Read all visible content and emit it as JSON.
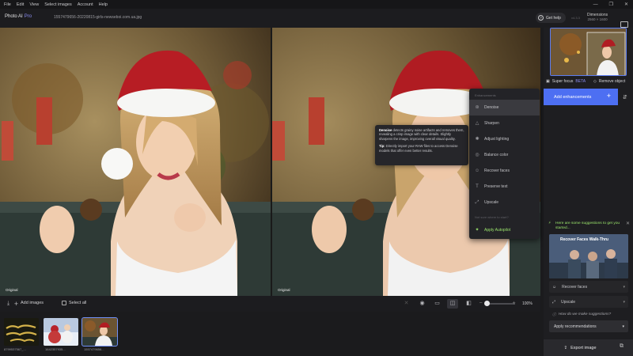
{
  "menubar": {
    "items": [
      "File",
      "Edit",
      "View",
      "Select images",
      "Account",
      "Help"
    ]
  },
  "window_controls": {
    "minimize": "—",
    "restore": "❐",
    "close": "✕"
  },
  "app": {
    "name": "Photo AI",
    "edition": "Pro",
    "file_name": "1557479656-20220815-girls-newseboi.com.ua.jpg",
    "version": "v4.3.3"
  },
  "help": {
    "label": "Get help"
  },
  "dimensions": {
    "label": "Dimensions",
    "value": "2560 × 1600"
  },
  "viewer": {
    "left_label": "Original",
    "right_label": "Original"
  },
  "tooltip": {
    "title": "Denoise",
    "body": "detects grainy noise artifacts and removes them, revealing a crisp image with clear details. Slightly sharpens the image, improving overall visual quality.",
    "tip_label": "Tip:",
    "tip_body": "Directly import your RAW files to access Denoise models that offer even better results."
  },
  "enhance_menu": {
    "header": "Enhancements",
    "items": [
      {
        "label": "Denoise",
        "icon": "⊛"
      },
      {
        "label": "Sharpen",
        "icon": "△"
      },
      {
        "label": "Adjust lighting",
        "icon": "✺"
      },
      {
        "label": "Balance color",
        "icon": "◎"
      },
      {
        "label": "Recover faces",
        "icon": "☺"
      },
      {
        "label": "Preserve text",
        "icon": "T"
      },
      {
        "label": "Upscale",
        "icon": "⤢"
      }
    ],
    "subheader": "Not sure where to start?",
    "autopilot": {
      "label": "Apply Autopilot",
      "icon": "✦"
    }
  },
  "toolbar": {
    "add_images": "Add images",
    "select_all": "Select all",
    "zoom": "100%"
  },
  "filmstrip": [
    {
      "name": "8799537567_..."
    },
    {
      "name": "1642357935..."
    },
    {
      "name": "1557479656..."
    }
  ],
  "right_panel": {
    "super_focus": "Super focus",
    "beta": "BETA",
    "remove_object": "Remove object",
    "add_enhancements": "Add enhancements",
    "suggestions_head": "Here are some suggestions to get you started...",
    "video_title": "Recover Faces Walk-Thru",
    "suggestions": [
      {
        "label": "Recover faces",
        "icon": "☺"
      },
      {
        "label": "Upscale",
        "icon": "⤢"
      }
    ],
    "how_link": "How do we make suggestions?",
    "apply_rec": "Apply recommendations",
    "export": "Export image"
  },
  "colors": {
    "accent": "#4d6ff2",
    "autopilot": "#9be56c",
    "pro": "#8a8cf0"
  }
}
